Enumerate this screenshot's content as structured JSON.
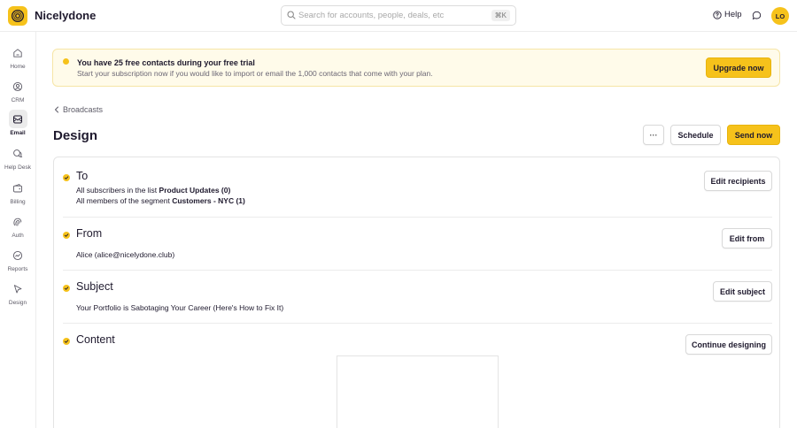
{
  "app": {
    "name": "Nicelydone"
  },
  "search": {
    "placeholder": "Search for accounts, people, deals, etc",
    "shortcut": "⌘K"
  },
  "topbar": {
    "help_label": "Help",
    "avatar_initials": "LO"
  },
  "sidebar": {
    "items": [
      {
        "label": "Home",
        "icon": "home-icon"
      },
      {
        "label": "CRM",
        "icon": "crm-icon"
      },
      {
        "label": "Email",
        "icon": "email-icon",
        "active": true
      },
      {
        "label": "Help Desk",
        "icon": "help-desk-icon"
      },
      {
        "label": "Billing",
        "icon": "billing-icon"
      },
      {
        "label": "Auth",
        "icon": "auth-icon"
      },
      {
        "label": "Reports",
        "icon": "reports-icon"
      },
      {
        "label": "Design",
        "icon": "design-icon"
      }
    ]
  },
  "banner": {
    "title": "You have 25 free contacts during your free trial",
    "text": "Start your subscription now if you would like to import or email the 1,000 contacts that come with your plan.",
    "button_label": "Upgrade now"
  },
  "breadcrumb": {
    "back_label": "Broadcasts"
  },
  "page": {
    "title": "Design"
  },
  "actions": {
    "more_label": "···",
    "schedule_label": "Schedule",
    "send_label": "Send now"
  },
  "sections": {
    "to": {
      "title": "To",
      "line1_prefix": "All subscribers in the list",
      "line1_value": "Product Updates (0)",
      "line2_prefix": "All members of the segment",
      "line2_value": "Customers - NYC (1)",
      "button_label": "Edit recipients"
    },
    "from": {
      "title": "From",
      "value": "Alice (alice@nicelydone.club)",
      "button_label": "Edit from"
    },
    "subject": {
      "title": "Subject",
      "value": "Your Portfolio is Sabotaging Your Career (Here's How to Fix It)",
      "button_label": "Edit subject"
    },
    "content": {
      "title": "Content",
      "button_label": "Continue designing"
    }
  },
  "colors": {
    "accent": "#f6c21b",
    "text": "#1f1a2e",
    "banner_bg": "#fffbea"
  }
}
